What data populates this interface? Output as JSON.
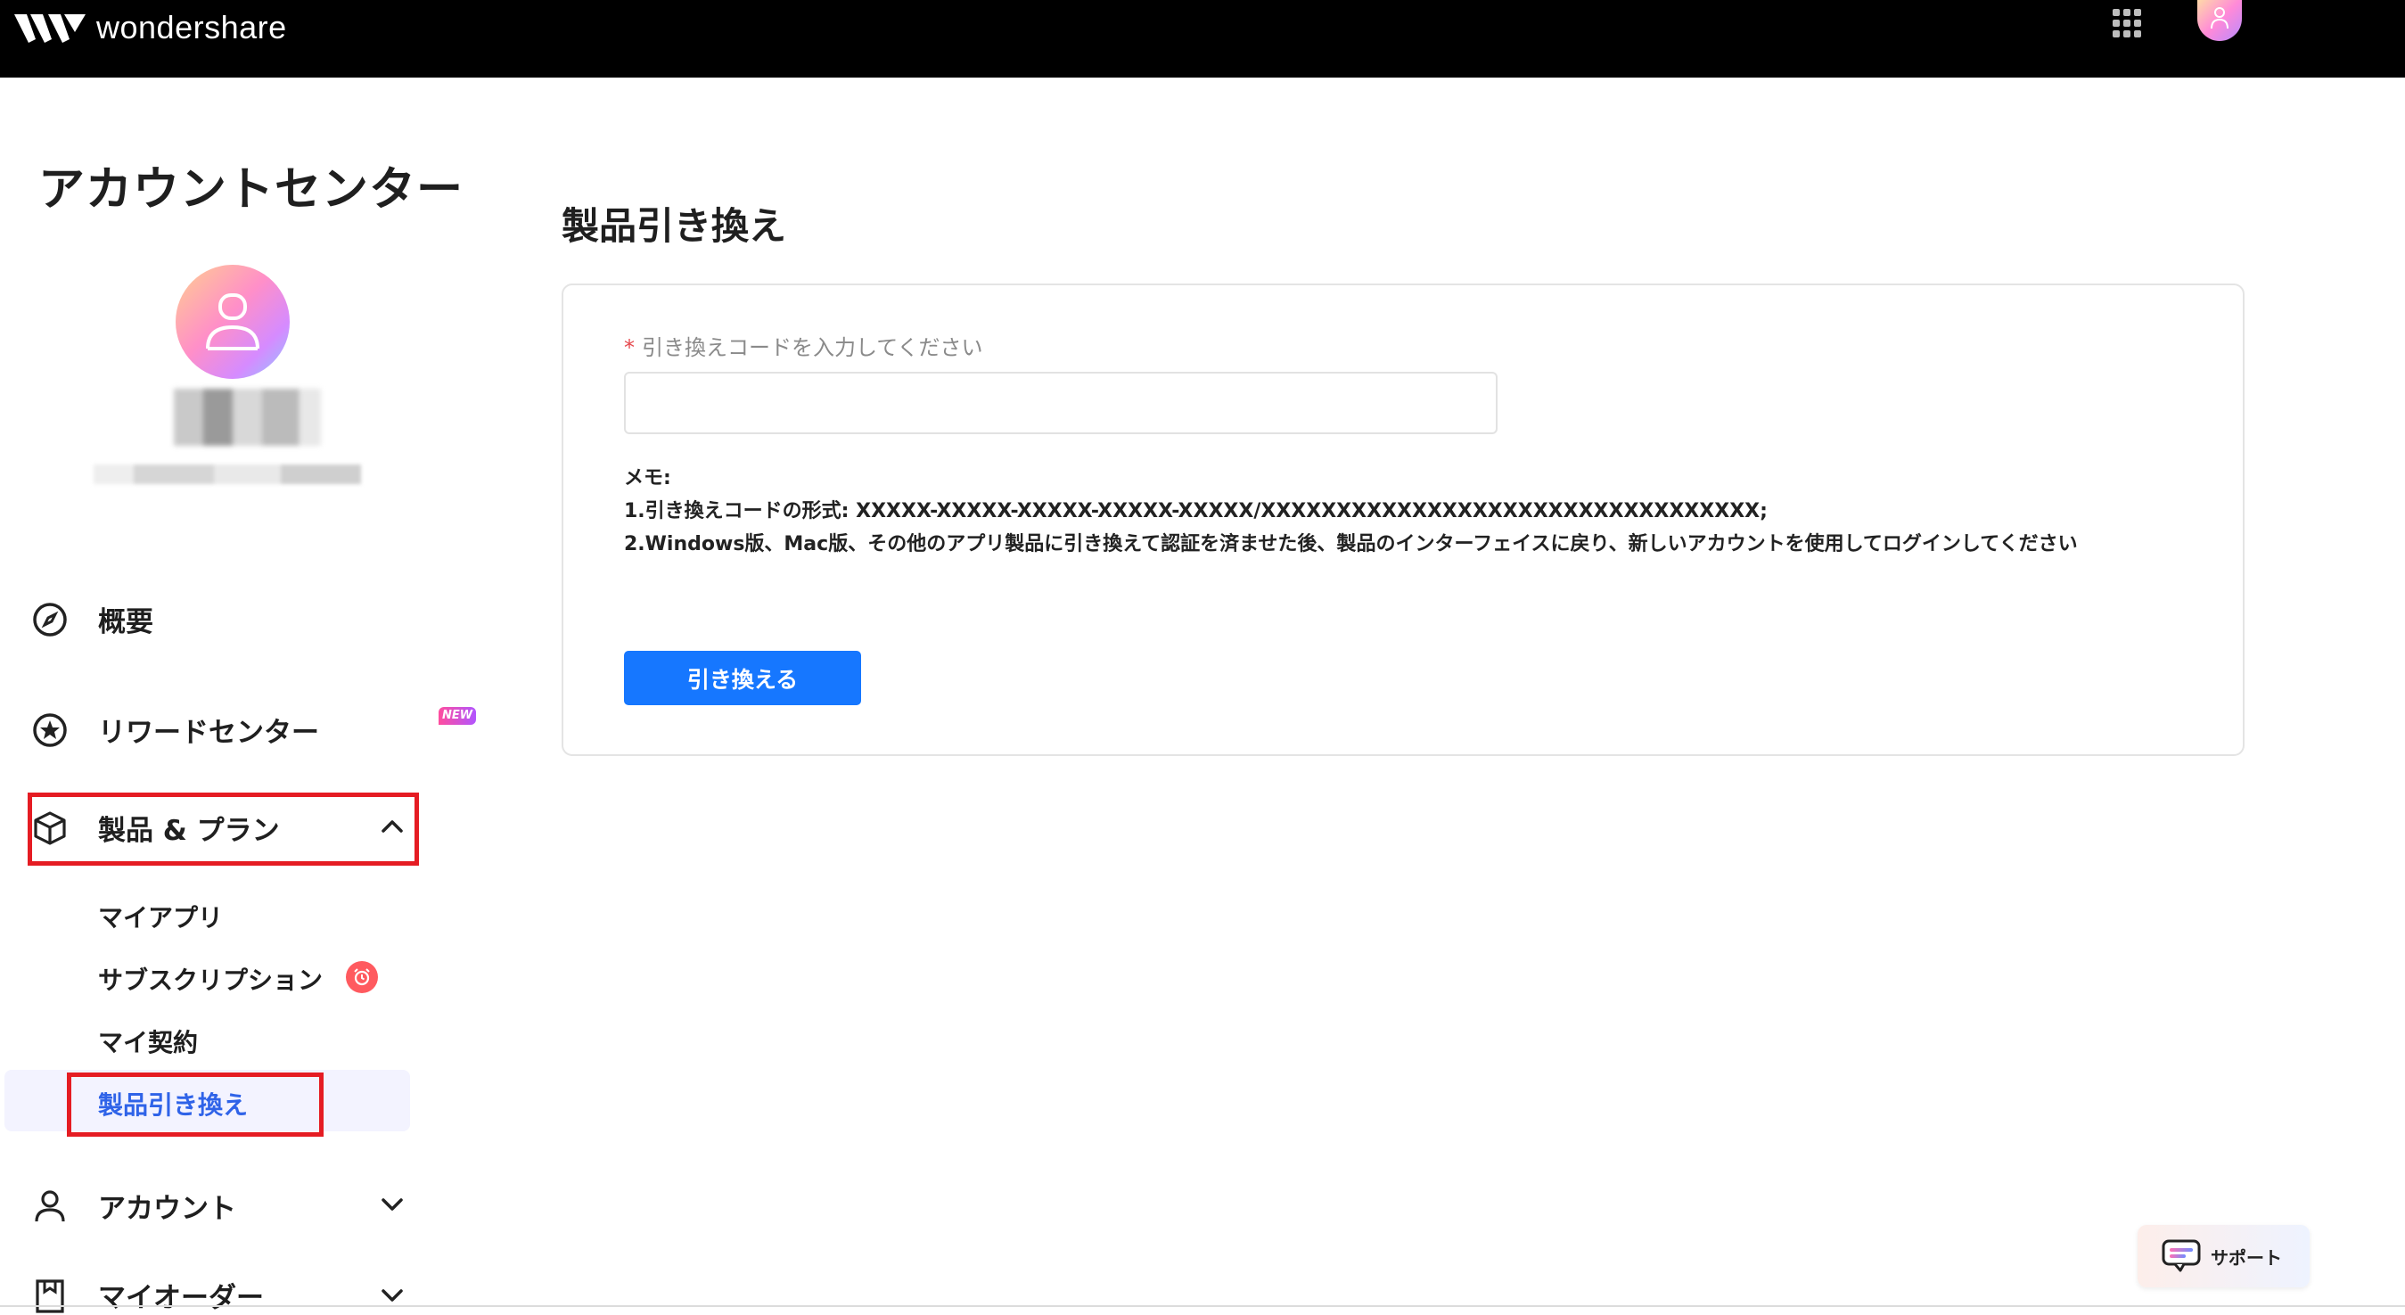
{
  "topbar": {
    "brand": "wondershare",
    "apps_icon": "apps-grid-icon",
    "avatar_icon": "user-avatar-icon"
  },
  "sidebar": {
    "title": "アカウントセンター",
    "items": [
      {
        "label": "概要",
        "icon": "compass-icon"
      },
      {
        "label": "リワードセンター",
        "icon": "star-badge-icon",
        "badge": "NEW"
      },
      {
        "label": "製品 & プラン",
        "icon": "box-icon",
        "expanded": true
      },
      {
        "label": "アカウント",
        "icon": "person-icon"
      },
      {
        "label": "マイオーダー",
        "icon": "order-icon"
      }
    ],
    "subitems": [
      {
        "label": "マイアプリ"
      },
      {
        "label": "サブスクリプション"
      },
      {
        "label": "マイ契約"
      },
      {
        "label": "製品引き換え",
        "active": true
      }
    ]
  },
  "main": {
    "title": "製品引き換え",
    "field_label": "引き換えコードを入力してください",
    "required_mark": "*",
    "input_value": "",
    "memo_title": "メモ:",
    "memo_line1": "1.引き換えコードの形式: XXXXX-XXXXX-XXXXX-XXXXX-XXXXX/XXXXXXXXXXXXXXXXXXXXXXXXXXXXXXXXX;",
    "memo_line2": "2.Windows版、Mac版、その他のアプリ製品に引き換えて認証を済ませた後、製品のインターフェイスに戻り、新しいアカウントを使用してログインしてください",
    "button": "引き換える"
  },
  "support": {
    "label": "サポート",
    "icon": "chat-icon"
  },
  "colors": {
    "accent": "#1677ff",
    "active_text": "#2f63e8",
    "highlight": "#e51c23",
    "topbar": "#000000"
  }
}
